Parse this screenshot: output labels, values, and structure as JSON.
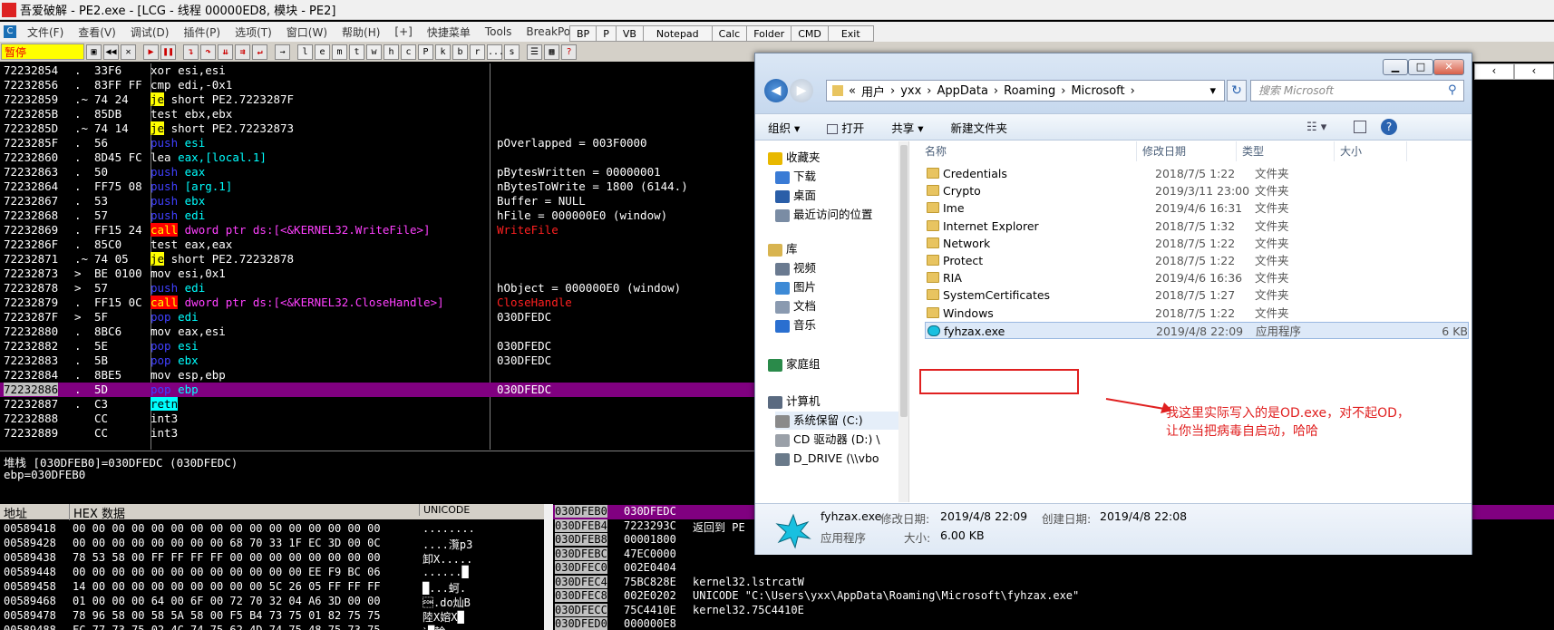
{
  "window": {
    "app_badge": "吾爱破解",
    "title": "吾爱破解 - PE2.exe - [LCG - 线程 00000ED8, 模块 - PE2]"
  },
  "menu": {
    "items": [
      "文件(F)",
      "查看(V)",
      "调试(D)",
      "插件(P)",
      "选项(T)",
      "窗口(W)",
      "帮助(H)",
      "[+]",
      "快捷菜单",
      "Tools",
      "BreakPoint->"
    ],
    "plugin_buttons": [
      "BP",
      "P",
      "VB",
      "Notepad",
      "Calc",
      "Folder",
      "CMD",
      "Exit"
    ]
  },
  "toolbar": {
    "status": "暂停",
    "letters": [
      "l",
      "e",
      "m",
      "t",
      "w",
      "h",
      "c",
      "P",
      "k",
      "b",
      "r",
      "...",
      "s"
    ]
  },
  "disasm": {
    "rows": [
      {
        "addr": "72232854",
        "mk": ".",
        "hex": "33F6",
        "mn": "xor",
        "mn_style": "mn",
        "op": "esi,esi",
        "op_style": "op-w",
        "cmt": ""
      },
      {
        "addr": "72232856",
        "mk": ".",
        "hex": "83FF FF",
        "mn": "cmp",
        "mn_style": "mn",
        "op": "edi,-0x1",
        "op_style": "op-w",
        "cmt": ""
      },
      {
        "addr": "72232859",
        "mk": ".~",
        "hex": "74 24",
        "mn": "je",
        "mn_style": "mn-y",
        "op": "short PE2.7223287F",
        "op_style": "op-w",
        "cmt": ""
      },
      {
        "addr": "7223285B",
        "mk": ".",
        "hex": "85DB",
        "mn": "test",
        "mn_style": "mn",
        "op": "ebx,ebx",
        "op_style": "op-w",
        "cmt": ""
      },
      {
        "addr": "7223285D",
        "mk": ".~",
        "hex": "74 14",
        "mn": "je",
        "mn_style": "mn-y",
        "op": "short PE2.72232873",
        "op_style": "op-w",
        "cmt": ""
      },
      {
        "addr": "7223285F",
        "mk": ".",
        "hex": "56",
        "mn": "push",
        "mn_style": "mn-b",
        "op": "esi",
        "op_style": "op-c",
        "cmt": "pOverlapped = 003F0000"
      },
      {
        "addr": "72232860",
        "mk": ".",
        "hex": "8D45 FC",
        "mn": "lea",
        "mn_style": "mn",
        "op": "eax,[local.1]",
        "op_style": "op-c",
        "cmt": ""
      },
      {
        "addr": "72232863",
        "mk": ".",
        "hex": "50",
        "mn": "push",
        "mn_style": "mn-b",
        "op": "eax",
        "op_style": "op-c",
        "cmt": "pBytesWritten = 00000001"
      },
      {
        "addr": "72232864",
        "mk": ".",
        "hex": "FF75 08",
        "mn": "push",
        "mn_style": "mn-b",
        "op": "[arg.1]",
        "op_style": "op-c",
        "cmt": "nBytesToWrite = 1800 (6144.)"
      },
      {
        "addr": "72232867",
        "mk": ".",
        "hex": "53",
        "mn": "push",
        "mn_style": "mn-b",
        "op": "ebx",
        "op_style": "op-c",
        "cmt": "Buffer = NULL"
      },
      {
        "addr": "72232868",
        "mk": ".",
        "hex": "57",
        "mn": "push",
        "mn_style": "mn-b",
        "op": "edi",
        "op_style": "op-c",
        "cmt": "hFile = 000000E0 (window)"
      },
      {
        "addr": "72232869",
        "mk": ".",
        "hex": "FF15 24",
        "mn": "call",
        "mn_style": "mn-r",
        "op": "dword ptr ds:[<&KERNEL32.WriteFile>]",
        "op_style": "op-m",
        "cmt": "WriteFile"
      },
      {
        "addr": "7223286F",
        "mk": ".",
        "hex": "85C0",
        "mn": "test",
        "mn_style": "mn",
        "op": "eax,eax",
        "op_style": "op-w",
        "cmt": ""
      },
      {
        "addr": "72232871",
        "mk": ".~",
        "hex": "74 05",
        "mn": "je",
        "mn_style": "mn-y",
        "op": "short PE2.72232878",
        "op_style": "op-w",
        "cmt": ""
      },
      {
        "addr": "72232873",
        "mk": ">",
        "hex": "BE 0100",
        "mn": "mov",
        "mn_style": "mn",
        "op": "esi,0x1",
        "op_style": "op-w",
        "cmt": ""
      },
      {
        "addr": "72232878",
        "mk": ">",
        "hex": "57",
        "mn": "push",
        "mn_style": "mn-b",
        "op": "edi",
        "op_style": "op-c",
        "cmt": "hObject = 000000E0 (window)"
      },
      {
        "addr": "72232879",
        "mk": ".",
        "hex": "FF15 0C",
        "mn": "call",
        "mn_style": "mn-r",
        "op": "dword ptr ds:[<&KERNEL32.CloseHandle>]",
        "op_style": "op-m",
        "cmt": "CloseHandle"
      },
      {
        "addr": "7223287F",
        "mk": ">",
        "hex": "5F",
        "mn": "pop",
        "mn_style": "mn-b",
        "op": "edi",
        "op_style": "op-c",
        "cmt": "030DFEDC"
      },
      {
        "addr": "72232880",
        "mk": ".",
        "hex": "8BC6",
        "mn": "mov",
        "mn_style": "mn",
        "op": "eax,esi",
        "op_style": "op-w",
        "cmt": ""
      },
      {
        "addr": "72232882",
        "mk": ".",
        "hex": "5E",
        "mn": "pop",
        "mn_style": "mn-b",
        "op": "esi",
        "op_style": "op-c",
        "cmt": "030DFEDC"
      },
      {
        "addr": "72232883",
        "mk": ".",
        "hex": "5B",
        "mn": "pop",
        "mn_style": "mn-b",
        "op": "ebx",
        "op_style": "op-c",
        "cmt": "030DFEDC"
      },
      {
        "addr": "72232884",
        "mk": ".",
        "hex": "8BE5",
        "mn": "mov",
        "mn_style": "mn",
        "op": "esp,ebp",
        "op_style": "op-w",
        "cmt": ""
      },
      {
        "addr": "72232886",
        "mk": ".",
        "hex": "5D",
        "mn": "pop",
        "mn_style": "mn-b",
        "op": "ebp",
        "op_style": "op-c",
        "cmt": "030DFEDC",
        "selected": true
      },
      {
        "addr": "72232887",
        "mk": ".",
        "hex": "C3",
        "mn": "retn",
        "mn_style": "mn-c",
        "op": "",
        "op_style": "op-w",
        "cmt": ""
      },
      {
        "addr": "72232888",
        "mk": "",
        "hex": "CC",
        "mn": "int3",
        "mn_style": "mn",
        "op": "",
        "op_style": "op-w",
        "cmt": ""
      },
      {
        "addr": "72232889",
        "mk": "",
        "hex": "CC",
        "mn": "int3",
        "mn_style": "mn",
        "op": "",
        "op_style": "op-w",
        "cmt": ""
      }
    ],
    "cmt_red": [
      "WriteFile",
      "CloseHandle"
    ]
  },
  "info": {
    "line1": "堆栈 [030DFEB0]=030DFEDC (030DFEDC)",
    "line2": "ebp=030DFEB0"
  },
  "dump": {
    "headers": [
      "地址",
      "HEX 数据",
      "UNICODE"
    ],
    "rows": [
      {
        "addr": "00589418",
        "hex": "00 00 00 00 00 00 00 00 00 00 00 00 00 00 00 00",
        "text": "........"
      },
      {
        "addr": "00589428",
        "hex": "00 00 00 00 00 00 00 00 68 70 33 1F EC 3D 00 0C",
        "text": "....灠p3"
      },
      {
        "addr": "00589438",
        "hex": "78 53 58 00 FF FF FF FF 00 00 00 00 00 00 00 00",
        "text": "卸X....."
      },
      {
        "addr": "00589448",
        "hex": "00 00 00 00 00 00 00 00 00 00 00 00 EE F9 BC 06",
        "text": "......█"
      },
      {
        "addr": "00589458",
        "hex": "14 00 00 00 00 00 00 00 00 00 5C 26 05 FF FF FF",
        "text": "█...蚵."
      },
      {
        "addr": "00589468",
        "hex": "01 00 00 00 64 00 6F 00 72 70 32 04 A6 3D 00 00",
        "text": "\u0001.do灿B"
      },
      {
        "addr": "00589478",
        "hex": "78 96 58 00 58 5A 58 00 F5 B4 73 75 01 82 75 75",
        "text": "陸X嫆X█"
      },
      {
        "addr": "00589488",
        "hex": "FC 77 73 75 02 4C 74 75 62 4D 74 75 48 75 73 75",
        "text": "ｼ█輪"
      }
    ]
  },
  "stack": {
    "rows": [
      {
        "addr": "030DFEB0",
        "val": "030DFEDC",
        "cmt": ""
      },
      {
        "addr": "030DFEB4",
        "val": "7223293C",
        "cmt": "返回到 PE"
      },
      {
        "addr": "030DFEB8",
        "val": "00001800",
        "cmt": ""
      },
      {
        "addr": "030DFEBC",
        "val": "47EC0000",
        "cmt": ""
      },
      {
        "addr": "030DFEC0",
        "val": "002E0404",
        "cmt": ""
      },
      {
        "addr": "030DFEC4",
        "val": "75BC828E",
        "cmt": "kernel32.lstrcatW"
      },
      {
        "addr": "030DFEC8",
        "val": "002E0202",
        "cmt": "UNICODE \"C:\\Users\\yxx\\AppData\\Roaming\\Microsoft\\fyhzax.exe\""
      },
      {
        "addr": "030DFECC",
        "val": "75C4410E",
        "cmt": "kernel32.75C4410E"
      },
      {
        "addr": "030DFED0",
        "val": "000000E8",
        "cmt": ""
      }
    ]
  },
  "explorer": {
    "breadcrumb": [
      "«",
      "用户",
      "yxx",
      "AppData",
      "Roaming",
      "Microsoft"
    ],
    "search_placeholder": "搜索 Microsoft",
    "commands": [
      "组织 ▾",
      "打开",
      "共享 ▾",
      "新建文件夹"
    ],
    "nav": [
      {
        "label": "收藏夹",
        "icon": "star-icon",
        "indent": 0
      },
      {
        "label": "下载",
        "icon": "download-folder-icon",
        "indent": 1
      },
      {
        "label": "桌面",
        "icon": "desktop-icon",
        "indent": 1
      },
      {
        "label": "最近访问的位置",
        "icon": "recent-places-icon",
        "indent": 1
      },
      {
        "label": "库",
        "icon": "library-icon",
        "indent": 0
      },
      {
        "label": "视频",
        "icon": "video-icon",
        "indent": 1
      },
      {
        "label": "图片",
        "icon": "picture-icon",
        "indent": 1
      },
      {
        "label": "文档",
        "icon": "document-icon",
        "indent": 1
      },
      {
        "label": "音乐",
        "icon": "music-icon",
        "indent": 1
      },
      {
        "label": "家庭组",
        "icon": "homegroup-icon",
        "indent": 0
      },
      {
        "label": "计算机",
        "icon": "computer-icon",
        "indent": 0
      },
      {
        "label": "系统保留 (C:)",
        "icon": "drive-icon",
        "indent": 1
      },
      {
        "label": "CD 驱动器 (D:) \\",
        "icon": "cd-drive-icon",
        "indent": 1
      },
      {
        "label": "D_DRIVE (\\\\vbo",
        "icon": "network-drive-icon",
        "indent": 1
      }
    ],
    "columns": [
      "名称",
      "修改日期",
      "类型",
      "大小"
    ],
    "files": [
      {
        "name": "Credentials",
        "date": "2018/7/5 1:22",
        "type": "文件夹",
        "size": ""
      },
      {
        "name": "Crypto",
        "date": "2019/3/11 23:00",
        "type": "文件夹",
        "size": ""
      },
      {
        "name": "Ime",
        "date": "2019/4/6 16:31",
        "type": "文件夹",
        "size": ""
      },
      {
        "name": "Internet Explorer",
        "date": "2018/7/5 1:32",
        "type": "文件夹",
        "size": ""
      },
      {
        "name": "Network",
        "date": "2018/7/5 1:22",
        "type": "文件夹",
        "size": ""
      },
      {
        "name": "Protect",
        "date": "2018/7/5 1:22",
        "type": "文件夹",
        "size": ""
      },
      {
        "name": "RIA",
        "date": "2019/4/6 16:36",
        "type": "文件夹",
        "size": ""
      },
      {
        "name": "SystemCertificates",
        "date": "2018/7/5 1:27",
        "type": "文件夹",
        "size": ""
      },
      {
        "name": "Windows",
        "date": "2018/7/5 1:22",
        "type": "文件夹",
        "size": ""
      },
      {
        "name": "fyhzax.exe",
        "date": "2019/4/8 22:09",
        "type": "应用程序",
        "size": "6 KB",
        "selected": true
      }
    ],
    "annotation": "我这里实际写入的是OD.exe，对不起OD，\n让你当把病毒自启动，哈哈",
    "details": {
      "name": "fyhzax.exe",
      "kind": "应用程序",
      "modified_label": "修改日期:",
      "modified": "2019/4/8 22:09",
      "created_label": "创建日期:",
      "created": "2019/4/8 22:08",
      "size_label": "大小:",
      "size": "6.00 KB"
    }
  },
  "colors": {
    "selection_row": "#800080",
    "annotation_red": "#e02020",
    "pause_bg": "#ffff00"
  }
}
